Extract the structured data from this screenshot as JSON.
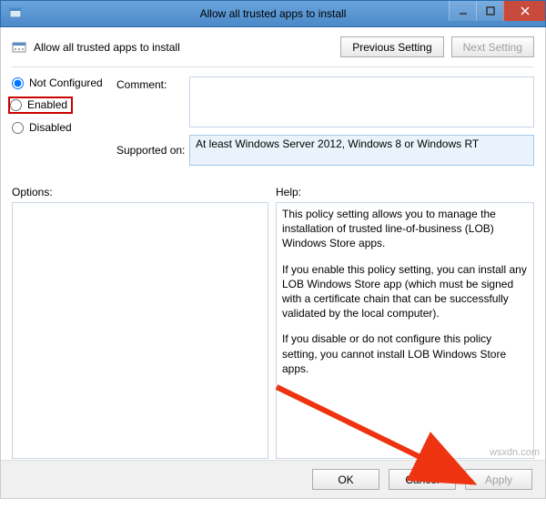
{
  "window": {
    "title": "Allow all trusted apps to install"
  },
  "header": {
    "title": "Allow all trusted apps to install",
    "prev": "Previous Setting",
    "next": "Next Setting"
  },
  "radios": {
    "not_configured": "Not Configured",
    "enabled": "Enabled",
    "disabled": "Disabled",
    "selected": "not_configured"
  },
  "labels": {
    "comment": "Comment:",
    "supported_on": "Supported on:",
    "options": "Options:",
    "help": "Help:"
  },
  "comment_text": "",
  "supported_text": "At least Windows Server 2012, Windows 8 or Windows RT",
  "help_paragraphs": [
    "This policy setting allows you to manage the installation of trusted line-of-business (LOB) Windows Store apps.",
    "If you enable this policy setting, you can install any LOB Windows Store app (which must be signed with a certificate chain that can be successfully validated by the local computer).",
    "If you disable or do not configure this policy setting, you cannot install LOB Windows Store apps."
  ],
  "buttons": {
    "ok": "OK",
    "cancel": "Cancel",
    "apply": "Apply"
  },
  "watermark": "wsxdn.com"
}
